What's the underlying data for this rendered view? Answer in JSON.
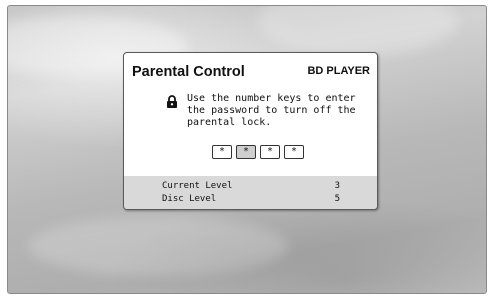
{
  "dialog": {
    "title": "Parental Control",
    "brand": "BD PLAYER",
    "message": "Use the number keys to enter the password to turn off the parental lock."
  },
  "password": {
    "digits": [
      "*",
      "*",
      "*",
      "*"
    ],
    "active_index": 1
  },
  "levels": {
    "current_label": "Current Level",
    "current_value": "3",
    "disc_label": "Disc Level",
    "disc_value": "5"
  },
  "icons": {
    "lock": "lock-icon"
  }
}
